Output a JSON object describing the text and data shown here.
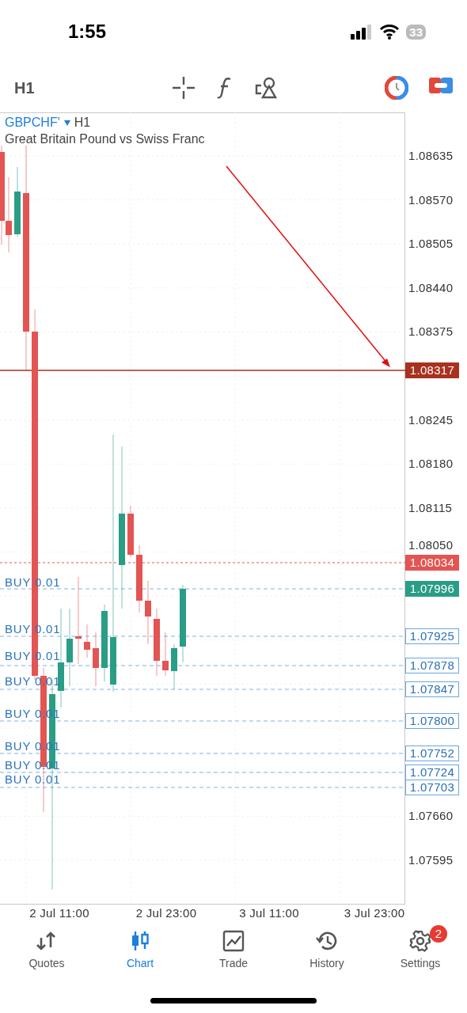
{
  "status_bar": {
    "time": "1:55",
    "battery": "33"
  },
  "toolbar": {
    "timeframe": "H1"
  },
  "chart": {
    "symbol": "GBPCHF'",
    "timeframe": "H1",
    "description": "Great Britain Pound vs Swiss Franc",
    "price_axis": [
      "1.08635",
      "1.08570",
      "1.08505",
      "1.08440",
      "1.08375",
      "1.08245",
      "1.08180",
      "1.08115",
      "1.08050",
      "1.07660",
      "1.07595"
    ],
    "price_tags": [
      {
        "kind": "line",
        "price": "1.08317",
        "color": "#a8311f"
      },
      {
        "kind": "ask",
        "price": "1.08034",
        "color": "#e35452"
      },
      {
        "kind": "bid",
        "price": "1.07996",
        "color": "#2a9d86"
      }
    ],
    "orders": [
      {
        "label": "BUY 0.01"
      },
      {
        "label": "BUY 0.01",
        "price": "1.07925"
      },
      {
        "label": "BUY 0.01",
        "price": "1.07878"
      },
      {
        "label": "BUY 0.01",
        "price": "1.07847"
      },
      {
        "label": "BUY 0.01",
        "price": "1.07800"
      },
      {
        "label": "BUY 0.01",
        "price": "1.07752"
      },
      {
        "label": "BUY 0.01",
        "price": "1.07724"
      },
      {
        "label": "BUY 0.01",
        "price": "1.07703"
      }
    ],
    "time_axis": [
      "2 Jul 11:00",
      "2 Jul 23:00",
      "3 Jul 11:00",
      "3 Jul 23:00"
    ]
  },
  "nav": [
    {
      "label": "Quotes",
      "selected": false
    },
    {
      "label": "Chart",
      "selected": true
    },
    {
      "label": "Trade",
      "selected": false
    },
    {
      "label": "History",
      "selected": false
    },
    {
      "label": "Settings",
      "selected": false,
      "badge": "2"
    }
  ]
}
